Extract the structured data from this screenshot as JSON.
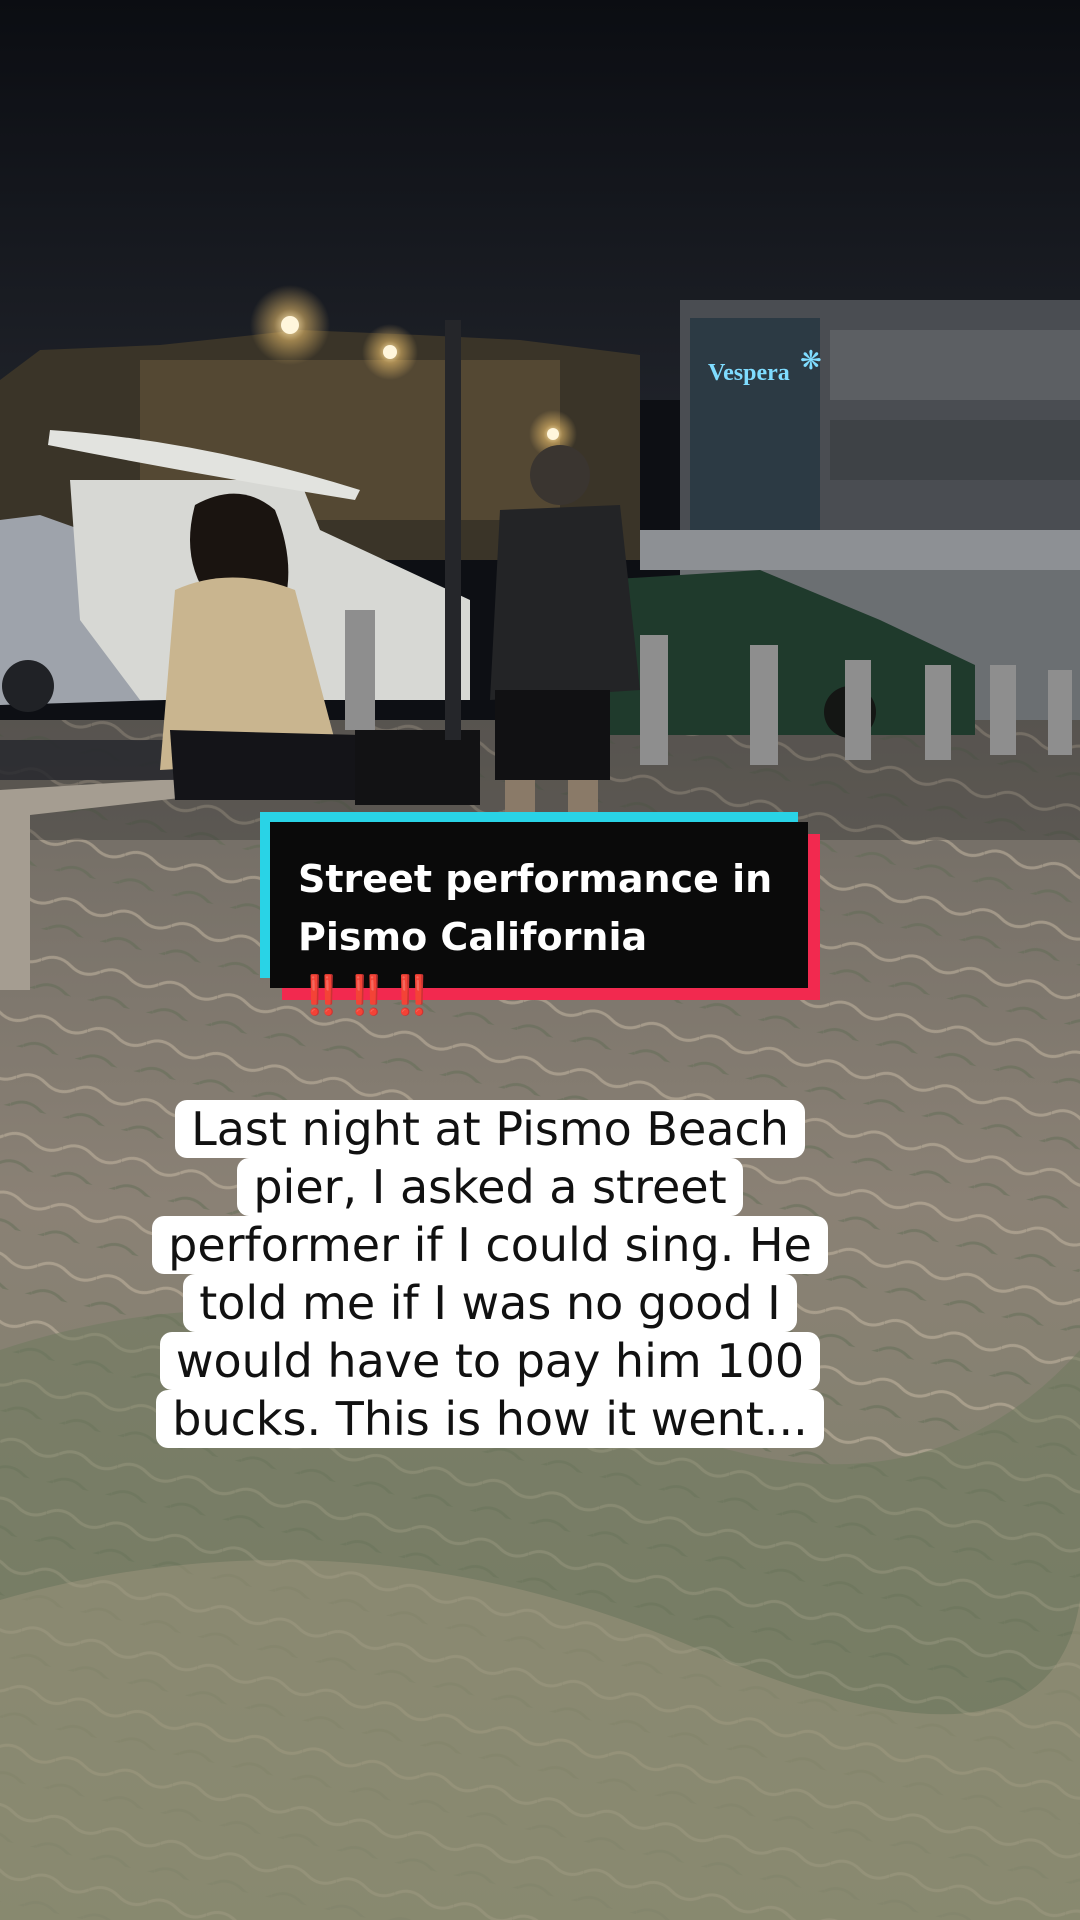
{
  "signage": {
    "hotel_name": "Vespera",
    "hotel_sign_color": "#7fdcff"
  },
  "caption": {
    "line1": "Street performance in",
    "line2": "Pismo California",
    "emphasis": "‼️‼️‼️",
    "colors": {
      "cyan": "#29d3e6",
      "red": "#f2294f"
    }
  },
  "story_text": {
    "lines": [
      "Last night at Pismo Beach",
      "pier, I asked a street",
      "performer if I could sing. He",
      "told me if I was no good I",
      "would have to pay him 100",
      "bucks. This is how it went..."
    ]
  }
}
